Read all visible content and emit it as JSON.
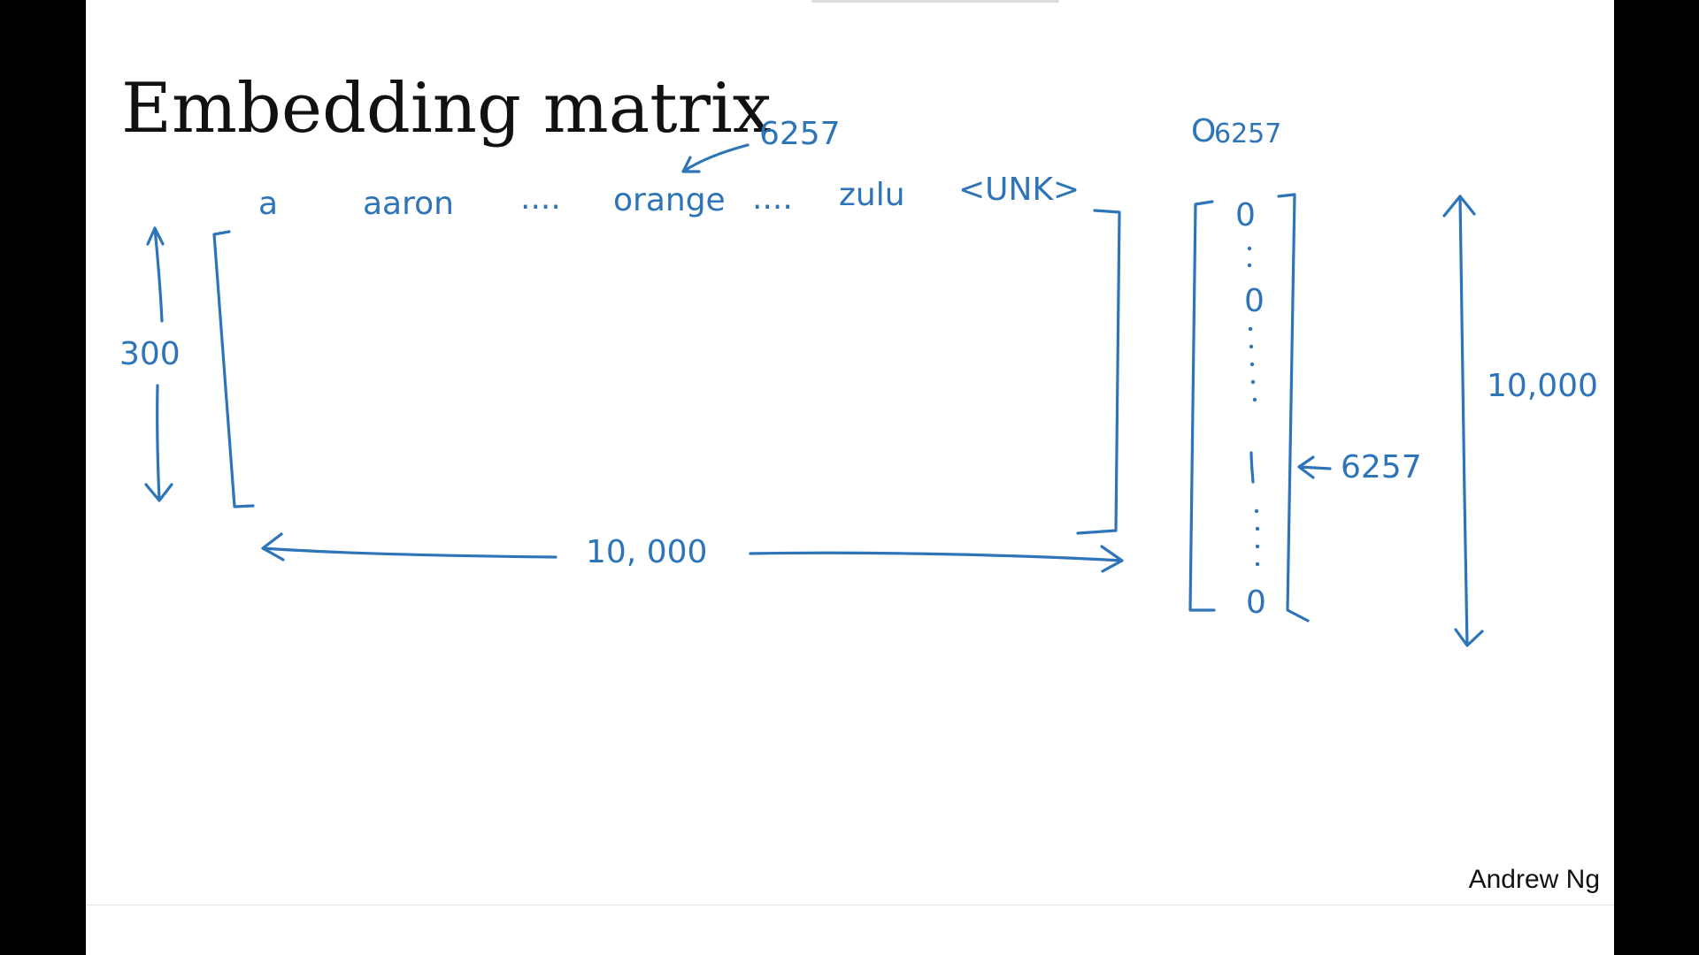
{
  "slide": {
    "title": "Embedding matrix",
    "author": "Andrew Ng"
  },
  "annotations": {
    "orange_index": "6257",
    "vocab_words": [
      "a",
      "aaron",
      "....",
      "orange",
      "....",
      "zulu",
      "<UNK>"
    ],
    "embedding_dim": "300",
    "vocab_size_horizontal": "10, 000",
    "one_hot_label": "O",
    "one_hot_subscript": "6257",
    "one_hot_entries": {
      "top": "0",
      "second": "0",
      "one": "1",
      "bottom": "0"
    },
    "one_hot_pointer": "6257",
    "vocab_size_vertical": "10,000"
  },
  "colors": {
    "ink": "#2e74b8",
    "title": "#111111",
    "background": "#ffffff",
    "letterbox": "#000000"
  }
}
